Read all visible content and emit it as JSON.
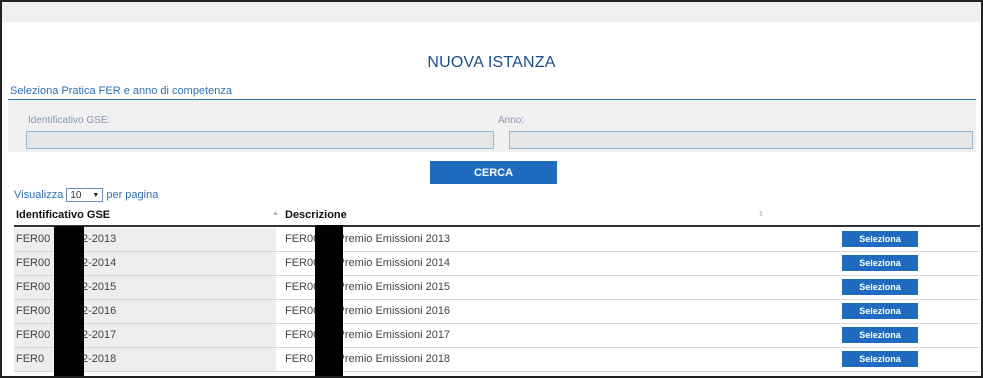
{
  "page_title": "NUOVA ISTANZA",
  "section_title": "Seleziona Pratica FER e anno di competenza",
  "form": {
    "id_label": "Identificativo GSE:",
    "id_value": "",
    "anno_label": "Anno:",
    "anno_value": "",
    "search_label": "CERCA"
  },
  "paging": {
    "prefix": "Visualizza",
    "page_size": "10",
    "suffix": "per pagina"
  },
  "table": {
    "columns": [
      "Identificativo GSE",
      "Descrizione"
    ],
    "rows": [
      {
        "id_prefix": "FER00",
        "id_suffix": "2-2013",
        "desc_prefix": "FER00",
        "desc_suffix": "-2 - Premio Emissioni 2013",
        "action": "Seleziona"
      },
      {
        "id_prefix": "FER00",
        "id_suffix": "2-2014",
        "desc_prefix": "FER00",
        "desc_suffix": "-2 - Premio Emissioni 2014",
        "action": "Seleziona"
      },
      {
        "id_prefix": "FER00",
        "id_suffix": "2-2015",
        "desc_prefix": "FER00",
        "desc_suffix": "-2 - Premio Emissioni 2015",
        "action": "Seleziona"
      },
      {
        "id_prefix": "FER00",
        "id_suffix": "2-2016",
        "desc_prefix": "FER00",
        "desc_suffix": "-2 - Premio Emissioni 2016",
        "action": "Seleziona"
      },
      {
        "id_prefix": "FER00",
        "id_suffix": "2-2017",
        "desc_prefix": "FER00",
        "desc_suffix": "-2 - Premio Emissioni 2017",
        "action": "Seleziona"
      },
      {
        "id_prefix": "FER0",
        "id_suffix": "2-2018",
        "desc_prefix": "FER0",
        "desc_suffix": "-2 - Premio Emissioni 2018",
        "action": "Seleziona"
      }
    ]
  },
  "colors": {
    "accent": "#1f6bc0",
    "title": "#1a4e8c"
  }
}
